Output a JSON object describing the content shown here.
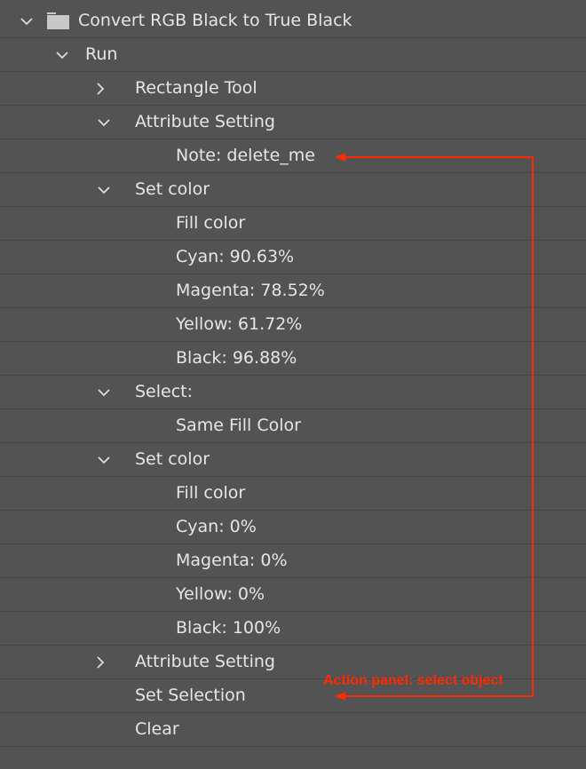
{
  "panel": {
    "title": "Convert RGB Black to True Black",
    "rows": [
      {
        "label": "Run",
        "expander": "chevron-down"
      },
      {
        "label": "Rectangle Tool",
        "expander": "chevron-right"
      },
      {
        "label": "Attribute Setting",
        "expander": "chevron-down"
      },
      {
        "label": "Note: delete_me",
        "expander": "none"
      },
      {
        "label": "Set color",
        "expander": "chevron-down"
      },
      {
        "label": "Fill color",
        "expander": "none"
      },
      {
        "label": "Cyan: 90.63%",
        "expander": "none"
      },
      {
        "label": "Magenta: 78.52%",
        "expander": "none"
      },
      {
        "label": "Yellow: 61.72%",
        "expander": "none"
      },
      {
        "label": "Black: 96.88%",
        "expander": "none"
      },
      {
        "label": "Select:",
        "expander": "chevron-down"
      },
      {
        "label": "Same Fill Color",
        "expander": "none"
      },
      {
        "label": "Set color",
        "expander": "chevron-down"
      },
      {
        "label": "Fill color",
        "expander": "none"
      },
      {
        "label": "Cyan: 0%",
        "expander": "none"
      },
      {
        "label": "Magenta: 0%",
        "expander": "none"
      },
      {
        "label": "Yellow: 0%",
        "expander": "none"
      },
      {
        "label": "Black: 100%",
        "expander": "none"
      },
      {
        "label": "Attribute Setting",
        "expander": "chevron-right"
      },
      {
        "label": "Set Selection",
        "expander": "none"
      },
      {
        "label": "Clear",
        "expander": "none"
      }
    ]
  },
  "annotation": {
    "text": "Action panel: select object",
    "color": "#ff2a00"
  },
  "colors": {
    "panel_background": "#535353",
    "row_divider": "#464646",
    "text": "#e6e6e6"
  }
}
